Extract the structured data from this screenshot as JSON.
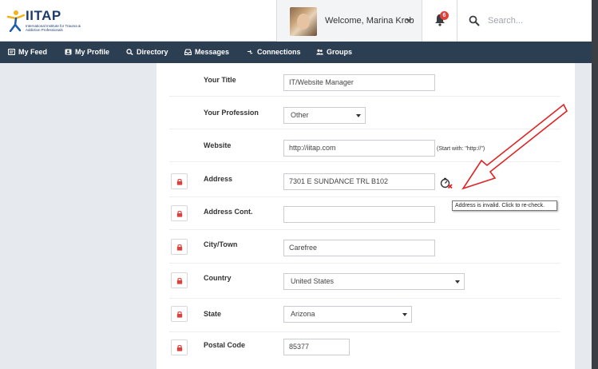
{
  "header": {
    "logo": {
      "brand": "IITAP",
      "tagline": "International Institute for Trauma & Addiction Professionals"
    },
    "user": {
      "welcome": "Welcome, Marina Krob"
    },
    "notifications": {
      "count": "6"
    },
    "search": {
      "placeholder": "Search..."
    }
  },
  "nav": {
    "items": [
      {
        "label": "My Feed",
        "icon": "feed-icon"
      },
      {
        "label": "My Profile",
        "icon": "profile-icon"
      },
      {
        "label": "Directory",
        "icon": "search-icon"
      },
      {
        "label": "Messages",
        "icon": "inbox-icon"
      },
      {
        "label": "Connections",
        "icon": "connections-icon"
      },
      {
        "label": "Groups",
        "icon": "groups-icon"
      }
    ]
  },
  "form": {
    "your_title": {
      "label": "Your Title",
      "value": "IT/Website Manager"
    },
    "profession": {
      "label": "Your Profession",
      "value": "Other"
    },
    "website": {
      "label": "Website",
      "value": "http://iitap.com",
      "hint": "(Start with: \"http://\")"
    },
    "address": {
      "label": "Address",
      "value": "7301 E SUNDANCE TRL B102",
      "tooltip": "Address is invalid. Click to re-check."
    },
    "address_cont": {
      "label": "Address Cont.",
      "value": ""
    },
    "city": {
      "label": "City/Town",
      "value": "Carefree"
    },
    "country": {
      "label": "Country",
      "value": "United States"
    },
    "state": {
      "label": "State",
      "value": "Arizona"
    },
    "postal": {
      "label": "Postal Code",
      "value": "85377"
    }
  },
  "colors": {
    "navbar": "#2c3f52",
    "badge": "#e0413b",
    "lock": "#d9433f",
    "annotation_arrow": "#e02424"
  }
}
